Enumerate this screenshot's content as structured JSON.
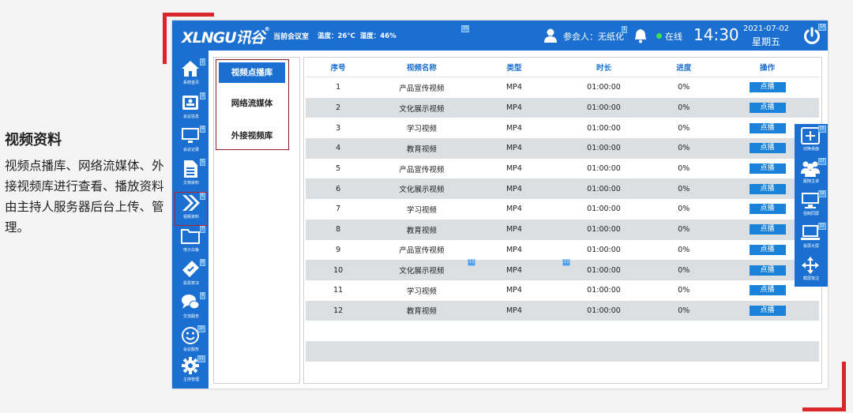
{
  "left_panel": {
    "title": "视频资料",
    "description": "视频点播库、网络流媒体、外接视频库进行查看、播放资料由主持人服务器后台上传、管理。"
  },
  "header": {
    "logo": "XLNGU讯谷",
    "logo_mark": "®",
    "room": "当前会议室",
    "temperature": "温度：26°C",
    "humidity": "湿度：46%",
    "participants": "参会人：无纸化",
    "status": "在线",
    "time": "14:30",
    "date": "2021-07-02",
    "weekday": "星期五",
    "badges": {
      "center": "23",
      "person": "1",
      "power": "14"
    }
  },
  "sidebar": {
    "items": [
      {
        "label": "系统首页",
        "icon": "home-icon",
        "num": "2"
      },
      {
        "label": "会议信息",
        "icon": "meeting-info-icon",
        "num": "3"
      },
      {
        "label": "会议记录",
        "icon": "monitor-icon",
        "num": "4"
      },
      {
        "label": "文档资料",
        "icon": "document-icon",
        "num": "5"
      },
      {
        "label": "视频资料",
        "icon": "video-forward-icon",
        "num": "6"
      },
      {
        "label": "电子白板",
        "icon": "folder-icon",
        "num": "7"
      },
      {
        "label": "投票表决",
        "icon": "vote-icon",
        "num": "8"
      },
      {
        "label": "交流服务",
        "icon": "chat-icon",
        "num": "9"
      },
      {
        "label": "会议服务",
        "icon": "smile-icon",
        "num": "10"
      },
      {
        "label": "主持管理",
        "icon": "gear-icon",
        "num": "11"
      }
    ]
  },
  "subnav": {
    "items": [
      "视频点播库",
      "网络流媒体",
      "外接视频库"
    ]
  },
  "table": {
    "headers": [
      "序号",
      "视频名称",
      "类型",
      "时长",
      "进度",
      "操作"
    ],
    "button_label": "点播",
    "rows": [
      {
        "no": "1",
        "name": "产品宣传视频",
        "type": "MP4",
        "duration": "01:00:00",
        "progress": "0%"
      },
      {
        "no": "2",
        "name": "文化展示视频",
        "type": "MP4",
        "duration": "01:00:00",
        "progress": "0%"
      },
      {
        "no": "3",
        "name": "学习视频",
        "type": "MP4",
        "duration": "01:00:00",
        "progress": "0%"
      },
      {
        "no": "4",
        "name": "教育视频",
        "type": "MP4",
        "duration": "01:00:00",
        "progress": "0%"
      },
      {
        "no": "5",
        "name": "产品宣传视频",
        "type": "MP4",
        "duration": "01:00:00",
        "progress": "0%"
      },
      {
        "no": "6",
        "name": "文化展示视频",
        "type": "MP4",
        "duration": "01:00:00",
        "progress": "0%"
      },
      {
        "no": "7",
        "name": "学习视频",
        "type": "MP4",
        "duration": "01:00:00",
        "progress": "0%"
      },
      {
        "no": "8",
        "name": "教育视频",
        "type": "MP4",
        "duration": "01:00:00",
        "progress": "0%"
      },
      {
        "no": "9",
        "name": "产品宣传视频",
        "type": "MP4",
        "duration": "01:00:00",
        "progress": "0%"
      },
      {
        "no": "10",
        "name": "文化展示视频",
        "type": "MP4",
        "duration": "01:00:00",
        "progress": "0%"
      },
      {
        "no": "11",
        "name": "学习视频",
        "type": "MP4",
        "duration": "01:00:00",
        "progress": "0%"
      },
      {
        "no": "12",
        "name": "教育视频",
        "type": "MP4",
        "duration": "01:00:00",
        "progress": "0%"
      }
    ],
    "table_badges": [
      "13",
      "13"
    ]
  },
  "tools": {
    "items": [
      {
        "label": "切换桌面",
        "icon": "split-screen-icon",
        "num": "15"
      },
      {
        "label": "跟随主讲",
        "icon": "group-icon",
        "num": "17"
      },
      {
        "label": "强制同屏",
        "icon": "screen-sync-icon",
        "num": "18"
      },
      {
        "label": "投屏大屏",
        "icon": "laptop-cast-icon",
        "num": "22"
      },
      {
        "label": "截屏批注",
        "icon": "move-arrows-icon",
        "num": ""
      }
    ]
  },
  "colors": {
    "primary": "#1a6fd0",
    "accent_red": "#d9262b",
    "row_alt": "#dcdfe2"
  }
}
